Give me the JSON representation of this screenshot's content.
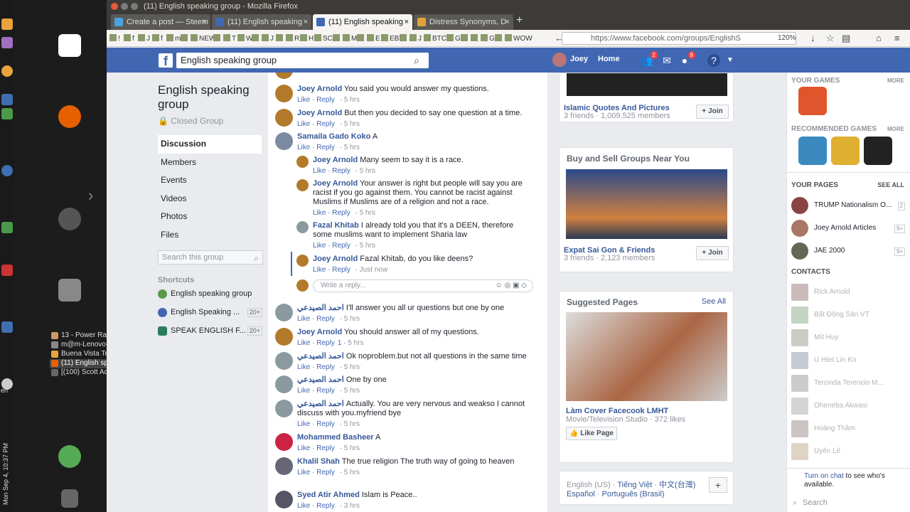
{
  "window": {
    "title": "(11) English speaking group - Mozilla Firefox"
  },
  "tabs": [
    {
      "label": "Create a post — Steem",
      "color": "#4aa3df"
    },
    {
      "label": "(11) English speaking",
      "color": "#4267b2"
    },
    {
      "label": "(11) English speaking",
      "color": "#4267b2"
    },
    {
      "label": "Distress Synonyms, D",
      "color": "#e2a23b"
    }
  ],
  "tab_new": "+",
  "tab_close": "×",
  "bookmarks": [
    "!",
    "f",
    "J",
    "f",
    "m",
    "",
    "NEW",
    "",
    "T",
    "W",
    "",
    "J",
    "",
    "R",
    "H",
    "SC",
    "",
    "M",
    "",
    "E",
    "EB",
    "",
    "J",
    "BTC",
    "G",
    "",
    "",
    "G",
    "",
    "WOW"
  ],
  "url": "https://www.facebook.com/groups/EnglishS",
  "zoom": "120%",
  "fb": {
    "logo": "f",
    "search_value": "English speaking group",
    "user": "Joey",
    "home": "Home",
    "friend_badge": "2",
    "notif_badge": "9",
    "help": "?"
  },
  "group": {
    "title": "English speaking group",
    "privacy": "Closed Group",
    "nav": [
      "Discussion",
      "Members",
      "Events",
      "Videos",
      "Photos",
      "Files"
    ],
    "search_placeholder": "Search this group",
    "shortcuts_label": "Shortcuts",
    "shortcuts": [
      {
        "label": "English speaking group",
        "count": ""
      },
      {
        "label": "English Speaking ...",
        "count": "20+"
      },
      {
        "label": "SPEAK ENGLISH F...",
        "count": "20+"
      }
    ]
  },
  "actions": {
    "like": "Like",
    "reply": "Reply"
  },
  "comments_top": [
    {
      "name": "",
      "text": "",
      "time": "5 hrs"
    },
    {
      "name": "Joey Arnold",
      "text": "You said you would answer my questions.",
      "time": "5 hrs"
    },
    {
      "name": "Joey Arnold",
      "text": "But then you decided to say one question at a time.",
      "time": "5 hrs"
    },
    {
      "name": "Samaila Gado Koko",
      "text": "A",
      "time": "5 hrs"
    }
  ],
  "replies": [
    {
      "name": "Joey Arnold",
      "text": "Many seem to say it is a race.",
      "time": "5 hrs"
    },
    {
      "name": "Joey Arnold",
      "text": "Your answer is right but people will say you are racist if you go against them. You cannot be racist against Muslims if Muslims are of a religion and not a race.",
      "time": "5 hrs"
    },
    {
      "name": "Fazal Khitab",
      "text": "I already told you that it's a DEEN, therefore some muslims want to implement Sharia law",
      "time": "5 hrs"
    },
    {
      "name": "Joey Arnold",
      "text": "Fazal Khitab, do you like deens?",
      "time": "Just now"
    }
  ],
  "reply_placeholder": "Write a reply...",
  "comments_bottom": [
    {
      "name": "احمد الصيدعي",
      "text": "I'll answer you all ur questions but one by one",
      "time": "5 hrs",
      "reactions": ""
    },
    {
      "name": "Joey Arnold",
      "text": "You should answer all of my questions.",
      "time": "5 hrs",
      "reactions": "1"
    },
    {
      "name": "احمد الصيدعي",
      "text": "Ok noproblem.but not all questions in the same time",
      "time": "5 hrs",
      "reactions": ""
    },
    {
      "name": "احمد الصيدعي",
      "text": "One by one",
      "time": "5 hrs",
      "reactions": ""
    },
    {
      "name": "احمد الصيدعي",
      "text": "Actually. You are very nervous and weakso I cannot discuss with you.myfriend bye",
      "time": "5 hrs",
      "reactions": ""
    },
    {
      "name": "Mohammed Basheer",
      "text": "A",
      "time": "5 hrs",
      "reactions": ""
    },
    {
      "name": "Khalil Shah",
      "text": "The true religion The truth way of going to heaven",
      "time": "5 hrs",
      "reactions": ""
    },
    {
      "name": "Syed Atir Ahmed",
      "text": "Islam is Peace..",
      "time": "3 hrs",
      "reactions": ""
    }
  ],
  "right": {
    "islamic": {
      "name": "Islamic Quotes And Pictures",
      "meta": "3 friends · 1,009,525 members",
      "join": "Join"
    },
    "buysell": {
      "heading": "Buy and Sell Groups Near You",
      "name": "Expat Sai Gon & Friends",
      "meta": "3 friends · 2,123 members",
      "join": "Join"
    },
    "suggested": {
      "heading": "Suggested Pages",
      "see_all": "See All",
      "name": "Làm Cover Facecook LMHT",
      "meta": "Movie/Television Studio · 372 likes",
      "like": "Like Page"
    },
    "languages": [
      "English (US)",
      "Tiếng Việt",
      "中文(台灣)",
      "Español",
      "Português (Brasil)"
    ],
    "lang_add": "+"
  },
  "sidebar": {
    "your_games": "YOUR GAMES",
    "more": "MORE",
    "recommended": "RECOMMENDED GAMES",
    "your_pages": "YOUR PAGES",
    "see_all": "SEE ALL",
    "pages": [
      {
        "name": "TRUMP Nationalism O...",
        "count": "2"
      },
      {
        "name": "Joey Arnold Articles",
        "count": "9+"
      },
      {
        "name": "JAE 2000",
        "count": "9+"
      }
    ],
    "contacts_label": "CONTACTS",
    "contacts": [
      "Rick Arnold",
      "Bất Động Sản VT",
      "Mít Huy",
      "U Htet Lin Ko",
      "Tercinda Terencio M...",
      "Oheneba Akwasi",
      "Hoàng Thâm",
      "Uyên Lê"
    ],
    "chat_link": "Turn on chat",
    "chat_text": " to see who's available.",
    "search_placeholder": "Search"
  },
  "desktop": {
    "windows": [
      "13 - Power Ran...",
      "m@m-Lenovo-...",
      "Buena Vista Te...",
      "(11) English sp...",
      "[(100) Scott Ad..."
    ],
    "clock": "Mon Sep 4, 10:37 PM",
    "lang": "en"
  }
}
